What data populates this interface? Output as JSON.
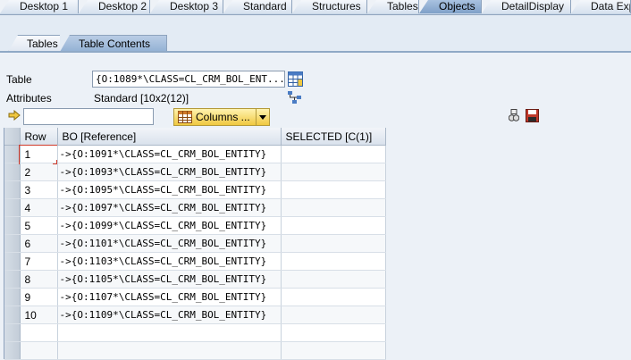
{
  "top_tabs": [
    "Desktop 1",
    "Desktop 2",
    "Desktop 3",
    "Standard",
    "Structures",
    "Tables",
    "Objects",
    "DetailDisplay",
    "Data Explo"
  ],
  "active_top_tab": "Objects",
  "sub_tabs": [
    "Tables",
    "Table Contents"
  ],
  "active_sub_tab": "Table Contents",
  "form": {
    "table_label": "Table",
    "table_value": "{O:1089*\\CLASS=CL_CRM_BOL_ENT...",
    "attributes_label": "Attributes",
    "attributes_value": "Standard [10x2(12)]"
  },
  "toolbar": {
    "input_value": "",
    "columns_label": "Columns ..."
  },
  "grid": {
    "headers": [
      "Row",
      "BO [Reference]",
      "SELECTED [C(1)]"
    ],
    "rows": [
      {
        "row": "1",
        "ref": "->{O:1091*\\CLASS=CL_CRM_BOL_ENTITY}",
        "selected": ""
      },
      {
        "row": "2",
        "ref": "->{O:1093*\\CLASS=CL_CRM_BOL_ENTITY}",
        "selected": ""
      },
      {
        "row": "3",
        "ref": "->{O:1095*\\CLASS=CL_CRM_BOL_ENTITY}",
        "selected": ""
      },
      {
        "row": "4",
        "ref": "->{O:1097*\\CLASS=CL_CRM_BOL_ENTITY}",
        "selected": ""
      },
      {
        "row": "5",
        "ref": "->{O:1099*\\CLASS=CL_CRM_BOL_ENTITY}",
        "selected": ""
      },
      {
        "row": "6",
        "ref": "->{O:1101*\\CLASS=CL_CRM_BOL_ENTITY}",
        "selected": ""
      },
      {
        "row": "7",
        "ref": "->{O:1103*\\CLASS=CL_CRM_BOL_ENTITY}",
        "selected": ""
      },
      {
        "row": "8",
        "ref": "->{O:1105*\\CLASS=CL_CRM_BOL_ENTITY}",
        "selected": ""
      },
      {
        "row": "9",
        "ref": "->{O:1107*\\CLASS=CL_CRM_BOL_ENTITY}",
        "selected": ""
      },
      {
        "row": "10",
        "ref": "->{O:1109*\\CLASS=CL_CRM_BOL_ENTITY}",
        "selected": ""
      }
    ]
  },
  "icons": {
    "table_picker": "table-grid-icon",
    "attributes": "structure-tree-icon",
    "entry_arrow": "arrow-right-icon",
    "columns": "table-columns-icon",
    "find": "binoculars-icon",
    "save": "floppy-disk-icon"
  },
  "colors": {
    "background": "#ecf1f7",
    "active_tab": "#8fadd2",
    "button_yellow": "#f0c840",
    "save_red": "#c0392b"
  }
}
